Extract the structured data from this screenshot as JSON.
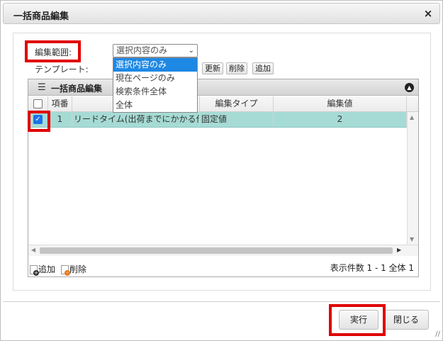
{
  "dialog": {
    "title": "一括商品編集",
    "close_icon": "×"
  },
  "form": {
    "range_label": "編集範囲:",
    "range_selected": "選択内容のみ",
    "range_options": [
      "選択内容のみ",
      "現在ページのみ",
      "検索条件全体",
      "全体"
    ],
    "template_label": "テンプレート:",
    "template_buttons": {
      "update": "更新",
      "delete": "削除",
      "add": "追加"
    }
  },
  "grid": {
    "title": "一括商品編集",
    "headers": {
      "num": "項番",
      "item": "",
      "edit_type": "編集タイプ",
      "edit_value": "編集値"
    },
    "rows": [
      {
        "checked": true,
        "num": "1",
        "item": "リードタイム(出荷までにかかる作業",
        "edit_type": "固定値",
        "edit_value": "2"
      }
    ],
    "footer": {
      "add": "追加",
      "delete": "削除",
      "count": "表示件数 1 - 1 全体 1"
    }
  },
  "actions": {
    "execute": "実行",
    "close": "閉じる"
  },
  "colors": {
    "highlight": "#e00000",
    "row_selected": "#a6dbd5",
    "option_selected": "#1e88e5"
  }
}
